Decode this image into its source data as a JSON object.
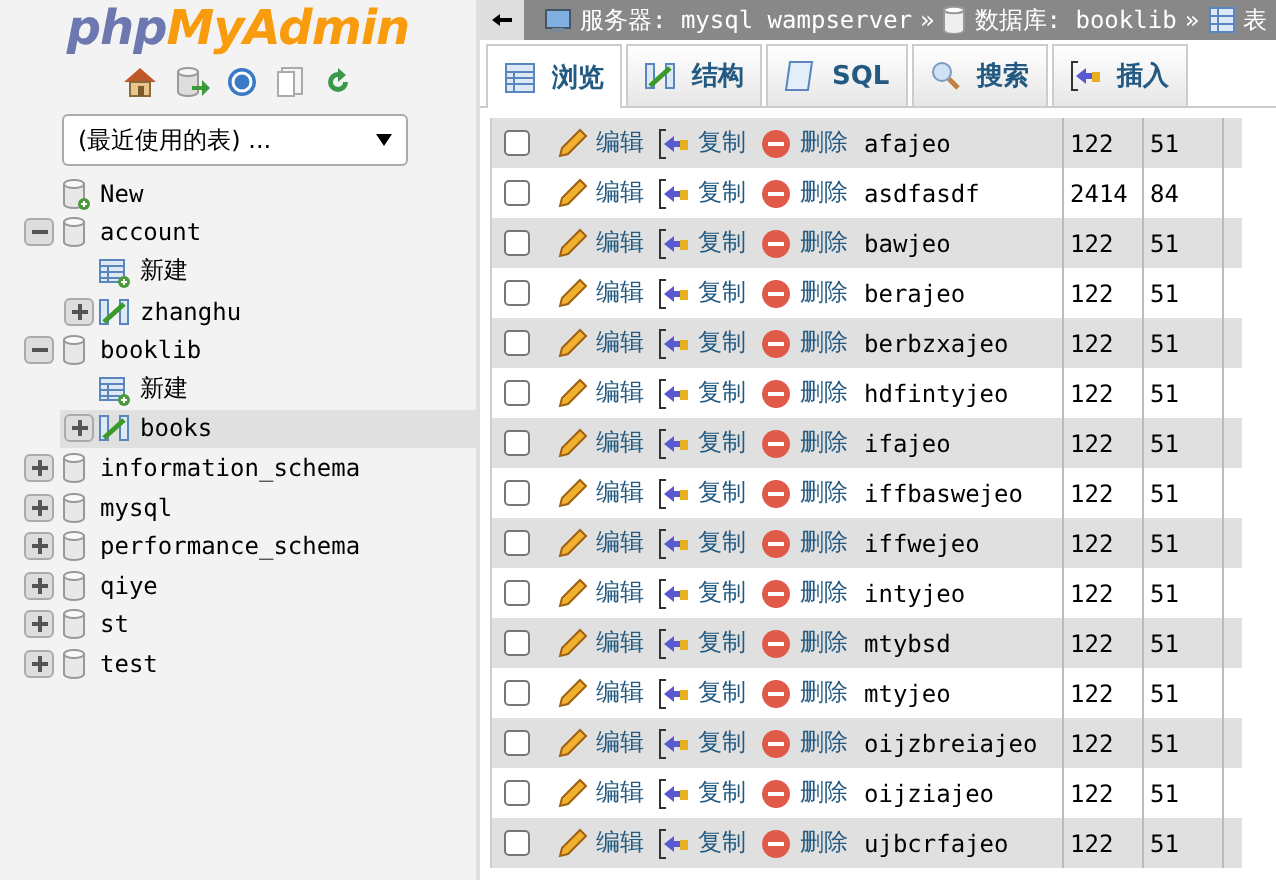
{
  "logo": {
    "part1": "php",
    "part2": "MyAdmin"
  },
  "recent_tables": {
    "value": "(最近使用的表) ..."
  },
  "tree": [
    {
      "label": "New",
      "kind": "new",
      "selected": false
    },
    {
      "label": "account",
      "kind": "db",
      "expanded": true,
      "selected": false,
      "children": [
        {
          "label": "新建",
          "kind": "new_table",
          "selected": false
        },
        {
          "label": "zhanghu",
          "kind": "table",
          "expanded": false,
          "selected": false
        }
      ]
    },
    {
      "label": "booklib",
      "kind": "db",
      "expanded": true,
      "selected": false,
      "children": [
        {
          "label": "新建",
          "kind": "new_table",
          "selected": false
        },
        {
          "label": "books",
          "kind": "table",
          "expanded": false,
          "selected": true
        }
      ]
    },
    {
      "label": "information_schema",
      "kind": "db",
      "expanded": false,
      "selected": false
    },
    {
      "label": "mysql",
      "kind": "db",
      "expanded": false,
      "selected": false
    },
    {
      "label": "performance_schema",
      "kind": "db",
      "expanded": false,
      "selected": false
    },
    {
      "label": "qiye",
      "kind": "db",
      "expanded": false,
      "selected": false
    },
    {
      "label": "st",
      "kind": "db",
      "expanded": false,
      "selected": false
    },
    {
      "label": "test",
      "kind": "db",
      "expanded": false,
      "selected": false
    }
  ],
  "breadcrumb": [
    {
      "kind": "server",
      "text": "服务器: mysql wampserver",
      "separator": "»"
    },
    {
      "kind": "database",
      "text": "数据库: booklib",
      "separator": "»"
    },
    {
      "kind": "table",
      "text": "表"
    }
  ],
  "tabs": [
    {
      "label": "浏览",
      "kind": "browse",
      "selected": true
    },
    {
      "label": "结构",
      "kind": "structure",
      "selected": false
    },
    {
      "label": "SQL",
      "kind": "sql",
      "selected": false
    },
    {
      "label": "搜索",
      "kind": "search",
      "selected": false
    },
    {
      "label": "插入",
      "kind": "insert",
      "selected": false
    }
  ],
  "rows": [
    {
      "checked": false,
      "edit": "编辑",
      "copy": "复制",
      "delete": "删除",
      "name": "afajeo",
      "column_2": "122",
      "column_3": "51"
    },
    {
      "checked": false,
      "edit": "编辑",
      "copy": "复制",
      "delete": "删除",
      "name": "asdfasdf",
      "column_2": "2414",
      "column_3": "84"
    },
    {
      "checked": false,
      "edit": "编辑",
      "copy": "复制",
      "delete": "删除",
      "name": "bawjeo",
      "column_2": "122",
      "column_3": "51"
    },
    {
      "checked": false,
      "edit": "编辑",
      "copy": "复制",
      "delete": "删除",
      "name": "berajeo",
      "column_2": "122",
      "column_3": "51"
    },
    {
      "checked": false,
      "edit": "编辑",
      "copy": "复制",
      "delete": "删除",
      "name": "berbzxajeo",
      "column_2": "122",
      "column_3": "51"
    },
    {
      "checked": false,
      "edit": "编辑",
      "copy": "复制",
      "delete": "删除",
      "name": "hdfintyjeo",
      "column_2": "122",
      "column_3": "51"
    },
    {
      "checked": false,
      "edit": "编辑",
      "copy": "复制",
      "delete": "删除",
      "name": "ifajeo",
      "column_2": "122",
      "column_3": "51"
    },
    {
      "checked": false,
      "edit": "编辑",
      "copy": "复制",
      "delete": "删除",
      "name": "iffbaswejeo",
      "column_2": "122",
      "column_3": "51"
    },
    {
      "checked": false,
      "edit": "编辑",
      "copy": "复制",
      "delete": "删除",
      "name": "iffwejeo",
      "column_2": "122",
      "column_3": "51"
    },
    {
      "checked": false,
      "edit": "编辑",
      "copy": "复制",
      "delete": "删除",
      "name": "intyjeo",
      "column_2": "122",
      "column_3": "51"
    },
    {
      "checked": false,
      "edit": "编辑",
      "copy": "复制",
      "delete": "删除",
      "name": "mtybsd",
      "column_2": "122",
      "column_3": "51"
    },
    {
      "checked": false,
      "edit": "编辑",
      "copy": "复制",
      "delete": "删除",
      "name": "mtyjeo",
      "column_2": "122",
      "column_3": "51"
    },
    {
      "checked": false,
      "edit": "编辑",
      "copy": "复制",
      "delete": "删除",
      "name": "oijzbreiajeo",
      "column_2": "122",
      "column_3": "51"
    },
    {
      "checked": false,
      "edit": "编辑",
      "copy": "复制",
      "delete": "删除",
      "name": "oijziajeo",
      "column_2": "122",
      "column_3": "51"
    },
    {
      "checked": false,
      "edit": "编辑",
      "copy": "复制",
      "delete": "删除",
      "name": "ujbcrfajeo",
      "column_2": "122",
      "column_3": "51"
    }
  ]
}
